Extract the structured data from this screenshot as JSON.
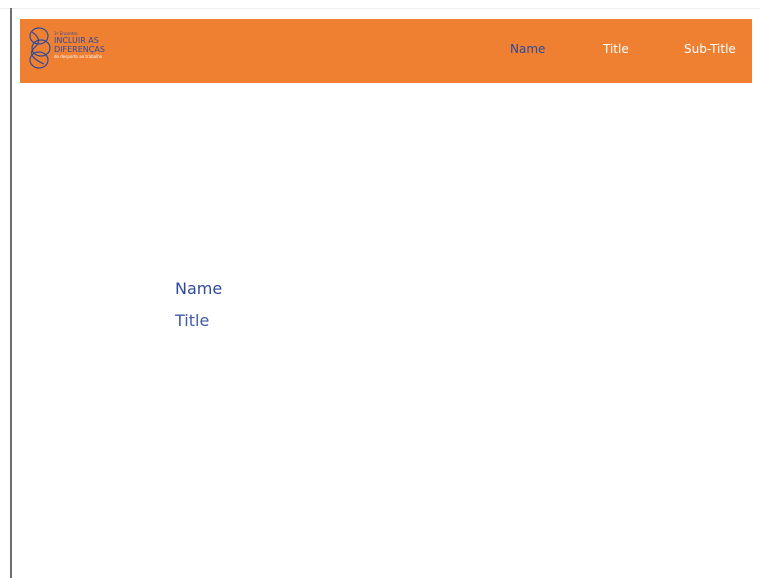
{
  "colors": {
    "header_bg": "#ef8032",
    "brand_blue": "#2f4a9c",
    "nav_inactive": "#ffffff",
    "page_bg": "#ffffff"
  },
  "logo": {
    "small_line": "1º Encontro",
    "main_line1": "INCLUIR AS",
    "main_line2": "DIFERENÇAS",
    "tagline": "do desporto ao trabalho",
    "icon": "intertwined-rings-icon"
  },
  "nav": {
    "name": "Name",
    "title": "Title",
    "subtitle": "Sub-Title"
  },
  "main": {
    "name": "Name",
    "title": "Title"
  }
}
